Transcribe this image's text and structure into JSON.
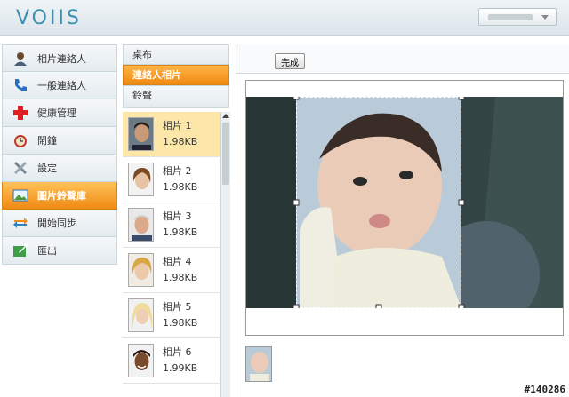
{
  "header": {
    "logo": "VOIIS"
  },
  "nav": [
    {
      "label": "相片連絡人",
      "icon": "contact-person-icon"
    },
    {
      "label": "一般連絡人",
      "icon": "phone-icon"
    },
    {
      "label": "健康管理",
      "icon": "red-cross-icon"
    },
    {
      "label": "鬧鐘",
      "icon": "alarm-clock-icon"
    },
    {
      "label": "設定",
      "icon": "tools-icon"
    },
    {
      "label": "圖片鈴聲庫",
      "icon": "picture-icon",
      "active": true
    },
    {
      "label": "開始同步",
      "icon": "sync-icon"
    },
    {
      "label": "匯出",
      "icon": "export-icon"
    }
  ],
  "categories": [
    {
      "label": "桌布"
    },
    {
      "label": "連絡人相片",
      "active": true
    },
    {
      "label": "鈴聲"
    }
  ],
  "photos": [
    {
      "name": "相片 1",
      "size": "1.98KB",
      "selected": true
    },
    {
      "name": "相片 2",
      "size": "1.98KB"
    },
    {
      "name": "相片 3",
      "size": "1.98KB"
    },
    {
      "name": "相片 4",
      "size": "1.98KB"
    },
    {
      "name": "相片 5",
      "size": "1.98KB"
    },
    {
      "name": "相片 6",
      "size": "1.99KB"
    }
  ],
  "toolbar": {
    "done_label": "完成"
  },
  "watermark": "#140286",
  "colors": {
    "accent": "#f08a12",
    "logo": "#3f8fb0"
  }
}
